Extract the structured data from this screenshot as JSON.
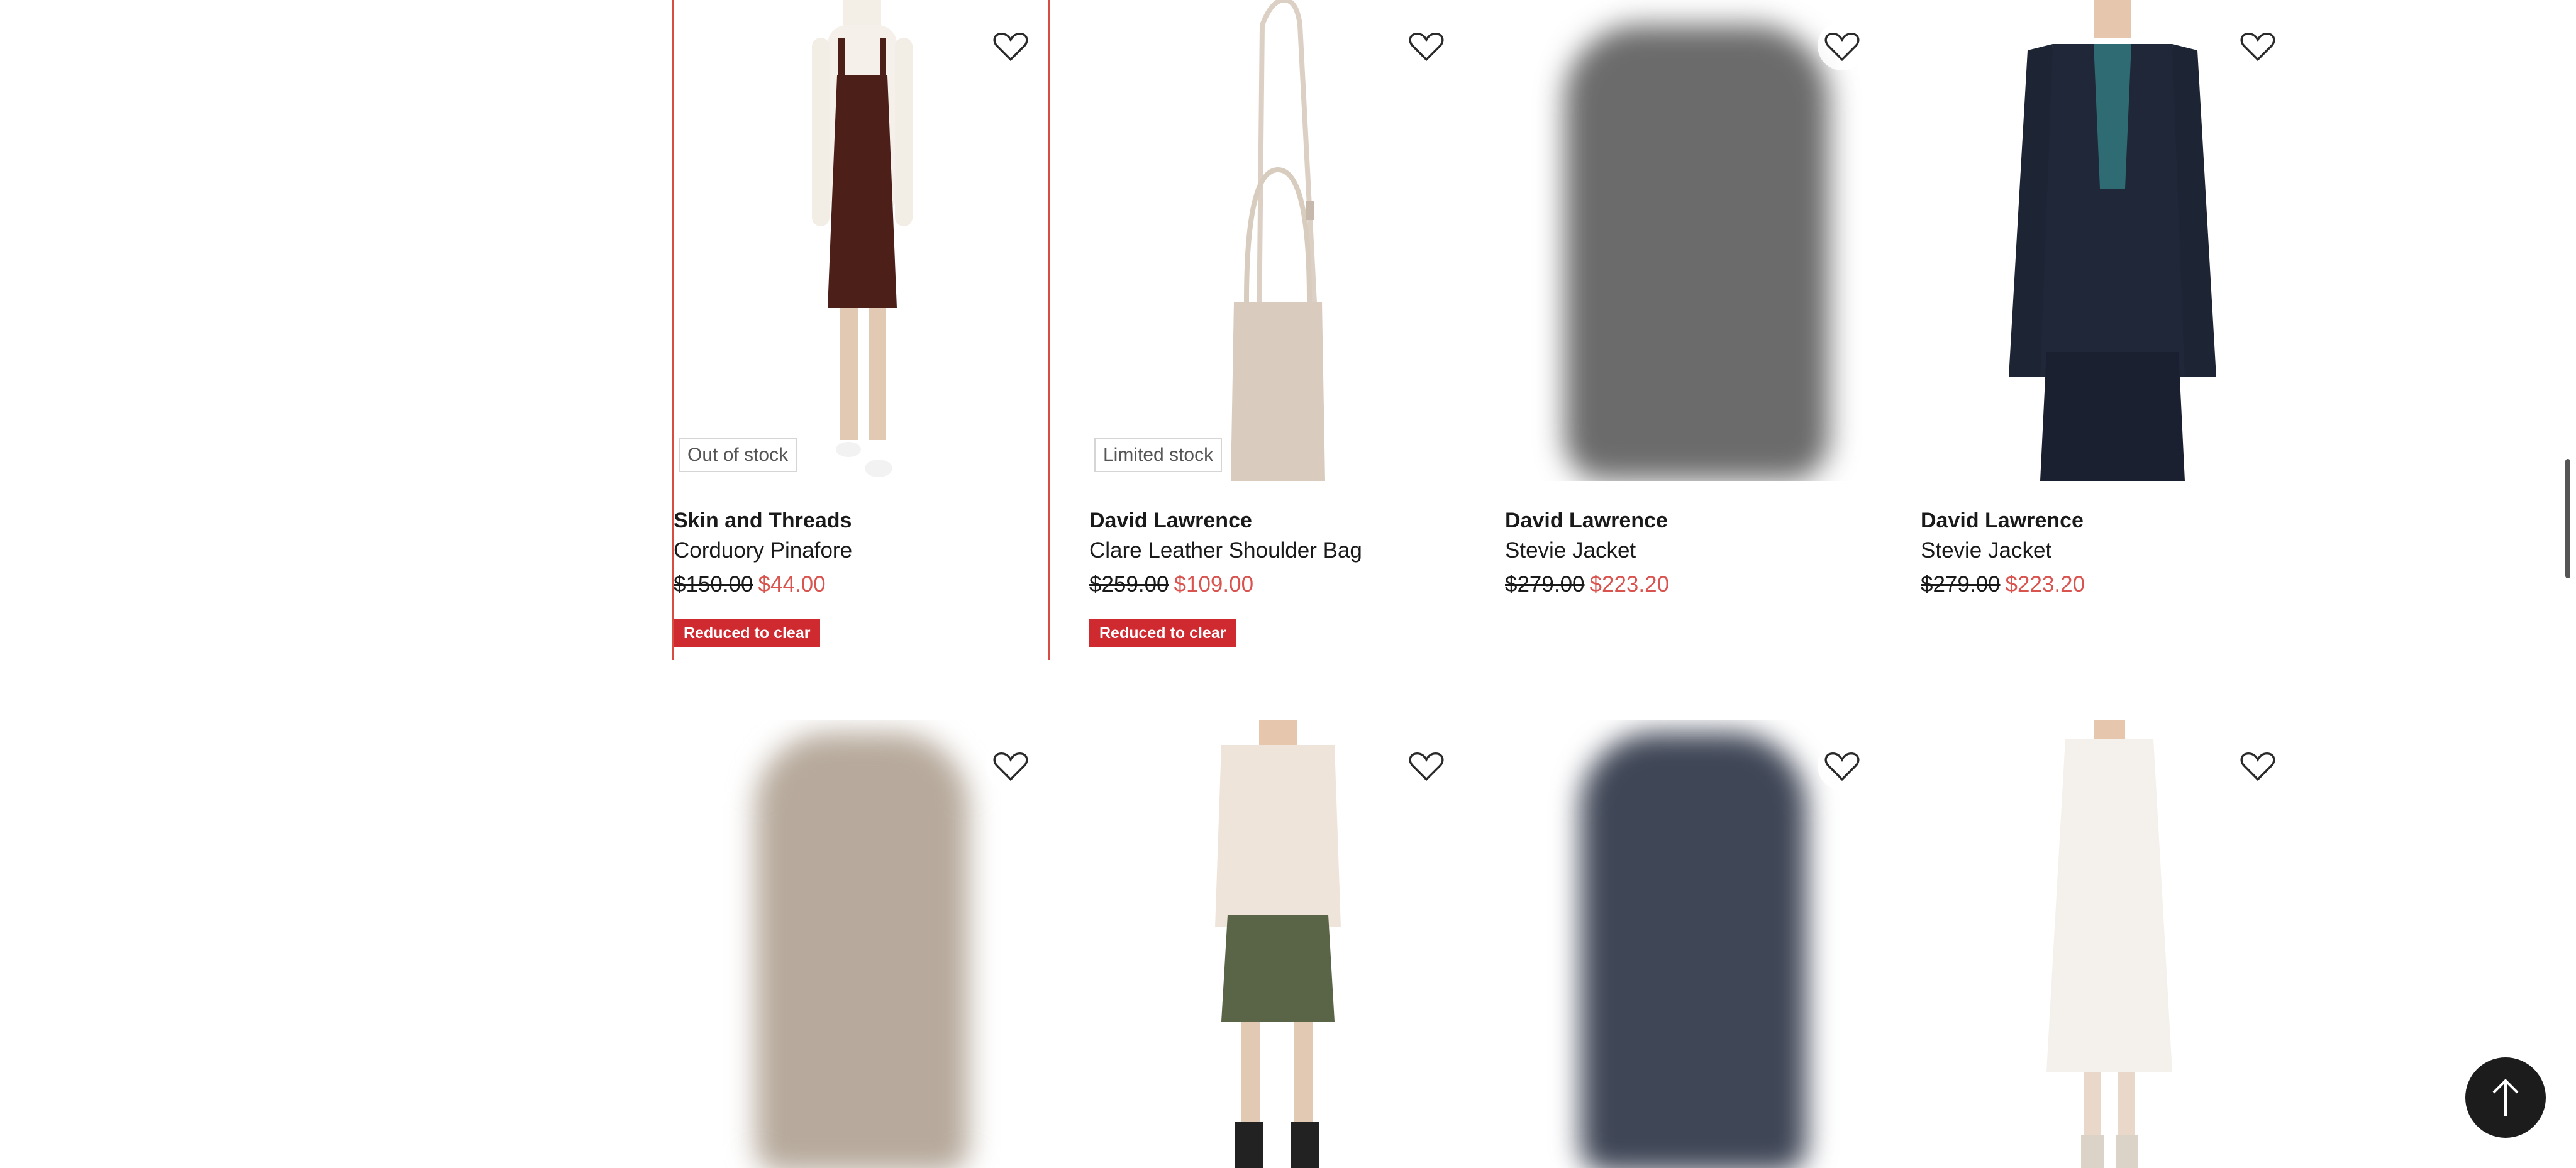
{
  "products": [
    {
      "brand": "Skin and Threads",
      "name": "Corduory Pinafore",
      "old_price": "$150.00",
      "new_price": "$44.00",
      "stock_label": "Out of stock",
      "badge": "Reduced to clear"
    },
    {
      "brand": "David Lawrence",
      "name": "Clare Leather Shoulder Bag",
      "old_price": "$259.00",
      "new_price": "$109.00",
      "stock_label": "Limited stock",
      "badge": "Reduced to clear"
    },
    {
      "brand": "David Lawrence",
      "name": "Stevie Jacket",
      "old_price": "$279.00",
      "new_price": "$223.20"
    },
    {
      "brand": "David Lawrence",
      "name": "Stevie Jacket",
      "old_price": "$279.00",
      "new_price": "$223.20"
    }
  ],
  "icons": {
    "wishlist": "heart-outline-icon",
    "back_to_top": "arrow-up-icon"
  },
  "colors": {
    "sale_price": "#d9534f",
    "badge_bg": "#d02a31",
    "selected_outline": "#d94c41"
  }
}
